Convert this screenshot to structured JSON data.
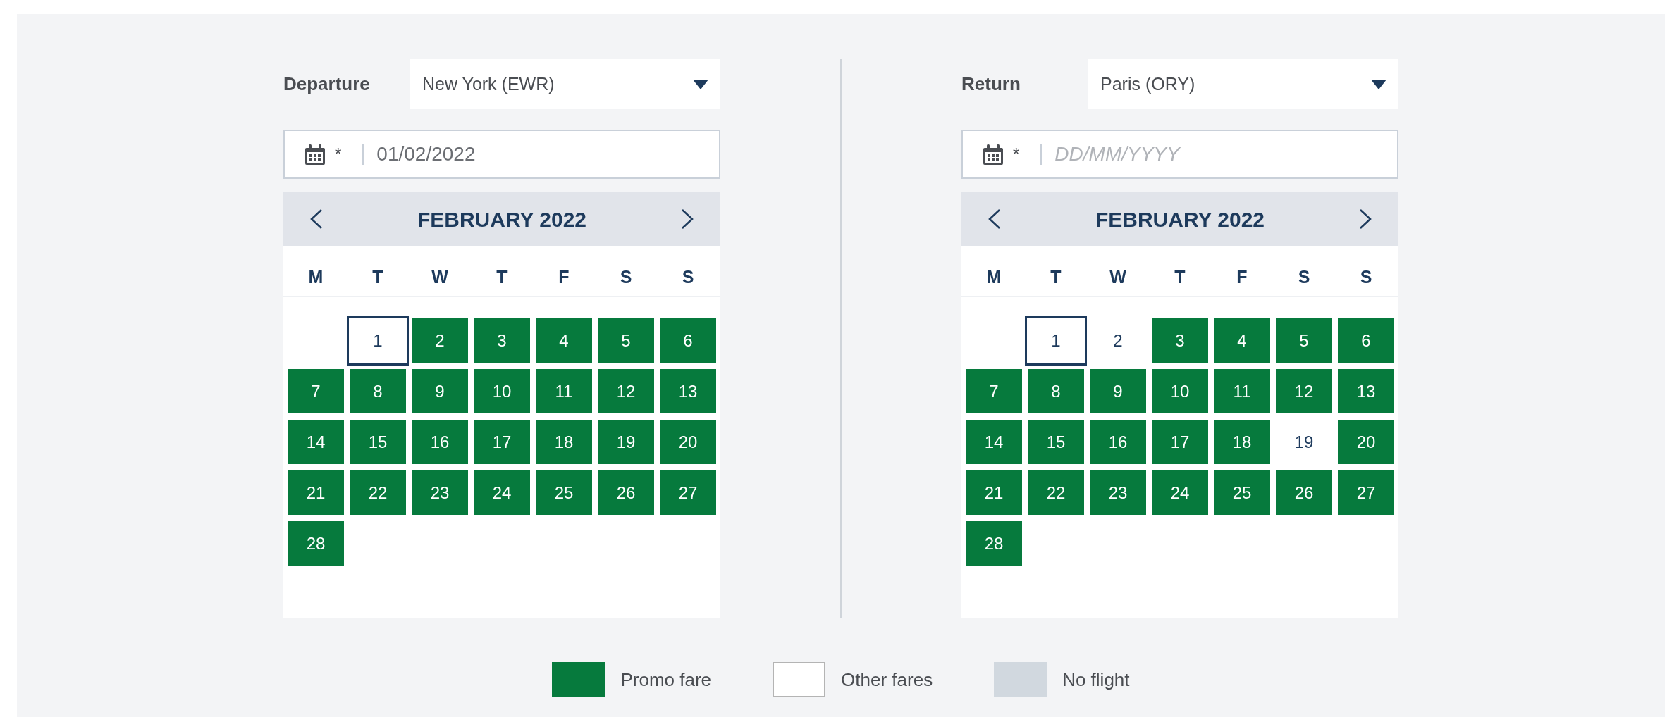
{
  "departure": {
    "label": "Departure",
    "airport": "New York (EWR)",
    "date_field": {
      "required_mark": "*",
      "value": "01/02/2022"
    },
    "calendar": {
      "title": "FEBRUARY 2022",
      "weekdays": [
        "M",
        "T",
        "W",
        "T",
        "F",
        "S",
        "S"
      ],
      "weeks": [
        [
          {
            "day": "1",
            "promo": false,
            "today": true
          },
          {
            "day": "2",
            "promo": true,
            "today": false
          },
          {
            "day": "3",
            "promo": true,
            "today": false
          },
          {
            "day": "4",
            "promo": true,
            "today": false
          },
          {
            "day": "5",
            "promo": true,
            "today": false
          },
          {
            "day": "6",
            "promo": true,
            "today": false
          }
        ],
        [
          {
            "day": "7",
            "promo": true,
            "today": false
          },
          {
            "day": "8",
            "promo": true,
            "today": false
          },
          {
            "day": "9",
            "promo": true,
            "today": false
          },
          {
            "day": "10",
            "promo": true,
            "today": false
          },
          {
            "day": "11",
            "promo": true,
            "today": false
          },
          {
            "day": "12",
            "promo": true,
            "today": false
          },
          {
            "day": "13",
            "promo": true,
            "today": false
          }
        ],
        [
          {
            "day": "14",
            "promo": true,
            "today": false
          },
          {
            "day": "15",
            "promo": true,
            "today": false
          },
          {
            "day": "16",
            "promo": true,
            "today": false
          },
          {
            "day": "17",
            "promo": true,
            "today": false
          },
          {
            "day": "18",
            "promo": true,
            "today": false
          },
          {
            "day": "19",
            "promo": true,
            "today": false
          },
          {
            "day": "20",
            "promo": true,
            "today": false
          }
        ],
        [
          {
            "day": "21",
            "promo": true,
            "today": false
          },
          {
            "day": "22",
            "promo": true,
            "today": false
          },
          {
            "day": "23",
            "promo": true,
            "today": false
          },
          {
            "day": "24",
            "promo": true,
            "today": false
          },
          {
            "day": "25",
            "promo": true,
            "today": false
          },
          {
            "day": "26",
            "promo": true,
            "today": false
          },
          {
            "day": "27",
            "promo": true,
            "today": false
          }
        ],
        [
          {
            "day": "28",
            "promo": true,
            "today": false
          }
        ]
      ]
    }
  },
  "return": {
    "label": "Return",
    "airport": "Paris (ORY)",
    "date_field": {
      "required_mark": "*",
      "placeholder": "DD/MM/YYYY"
    },
    "calendar": {
      "title": "FEBRUARY 2022",
      "weekdays": [
        "M",
        "T",
        "W",
        "T",
        "F",
        "S",
        "S"
      ],
      "weeks": [
        [
          {
            "day": "1",
            "promo": false,
            "today": true
          },
          {
            "day": "2",
            "promo": false,
            "today": false
          },
          {
            "day": "3",
            "promo": true,
            "today": false
          },
          {
            "day": "4",
            "promo": true,
            "today": false
          },
          {
            "day": "5",
            "promo": true,
            "today": false
          },
          {
            "day": "6",
            "promo": true,
            "today": false
          }
        ],
        [
          {
            "day": "7",
            "promo": true,
            "today": false
          },
          {
            "day": "8",
            "promo": true,
            "today": false
          },
          {
            "day": "9",
            "promo": true,
            "today": false
          },
          {
            "day": "10",
            "promo": true,
            "today": false
          },
          {
            "day": "11",
            "promo": true,
            "today": false
          },
          {
            "day": "12",
            "promo": true,
            "today": false
          },
          {
            "day": "13",
            "promo": true,
            "today": false
          }
        ],
        [
          {
            "day": "14",
            "promo": true,
            "today": false
          },
          {
            "day": "15",
            "promo": true,
            "today": false
          },
          {
            "day": "16",
            "promo": true,
            "today": false
          },
          {
            "day": "17",
            "promo": true,
            "today": false
          },
          {
            "day": "18",
            "promo": true,
            "today": false
          },
          {
            "day": "19",
            "promo": false,
            "today": false
          },
          {
            "day": "20",
            "promo": true,
            "today": false
          }
        ],
        [
          {
            "day": "21",
            "promo": true,
            "today": false
          },
          {
            "day": "22",
            "promo": true,
            "today": false
          },
          {
            "day": "23",
            "promo": true,
            "today": false
          },
          {
            "day": "24",
            "promo": true,
            "today": false
          },
          {
            "day": "25",
            "promo": true,
            "today": false
          },
          {
            "day": "26",
            "promo": true,
            "today": false
          },
          {
            "day": "27",
            "promo": true,
            "today": false
          }
        ],
        [
          {
            "day": "28",
            "promo": true,
            "today": false
          }
        ]
      ]
    }
  },
  "legend": [
    {
      "kind": "promo",
      "label": "Promo fare",
      "color": "#067a3d"
    },
    {
      "kind": "other",
      "label": "Other fares",
      "color": "#ffffff"
    },
    {
      "kind": "none",
      "label": "No flight",
      "color": "#d1d8df"
    }
  ]
}
